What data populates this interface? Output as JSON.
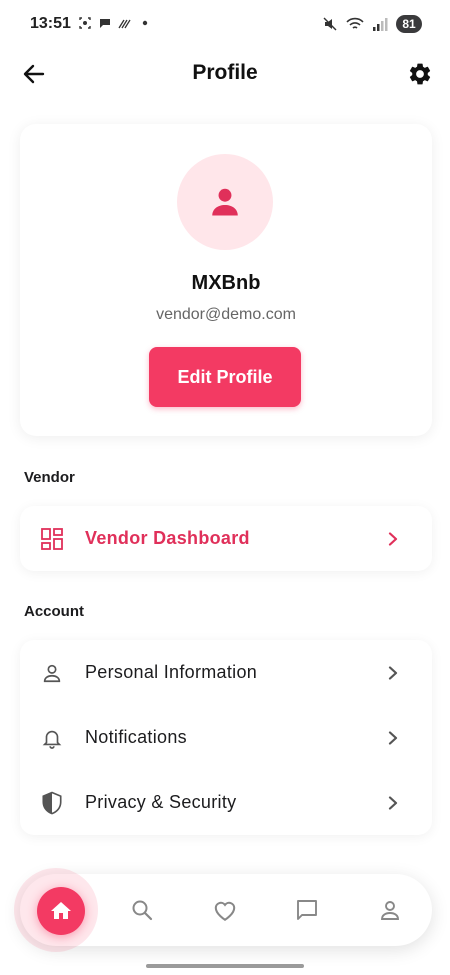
{
  "status_bar": {
    "time": "13:51",
    "battery": "81"
  },
  "header": {
    "title": "Profile"
  },
  "profile": {
    "name": "MXBnb",
    "email": "vendor@demo.com",
    "edit_label": "Edit Profile"
  },
  "sections": {
    "vendor": {
      "heading": "Vendor",
      "items": [
        {
          "label": "Vendor Dashboard",
          "icon": "dashboard-icon"
        }
      ]
    },
    "account": {
      "heading": "Account",
      "items": [
        {
          "label": "Personal Information",
          "icon": "person-icon"
        },
        {
          "label": "Notifications",
          "icon": "bell-icon"
        },
        {
          "label": "Privacy & Security",
          "icon": "shield-icon"
        }
      ]
    }
  },
  "bottom_nav": {
    "items": [
      {
        "icon": "home-icon",
        "active": true
      },
      {
        "icon": "search-icon",
        "active": false
      },
      {
        "icon": "heart-icon",
        "active": false
      },
      {
        "icon": "chat-icon",
        "active": false
      },
      {
        "icon": "person-icon",
        "active": false
      }
    ]
  },
  "colors": {
    "accent": "#f33a63",
    "accent_light": "#ffe6ea",
    "text_primary": "#1c1c1e",
    "text_secondary": "#666666"
  }
}
